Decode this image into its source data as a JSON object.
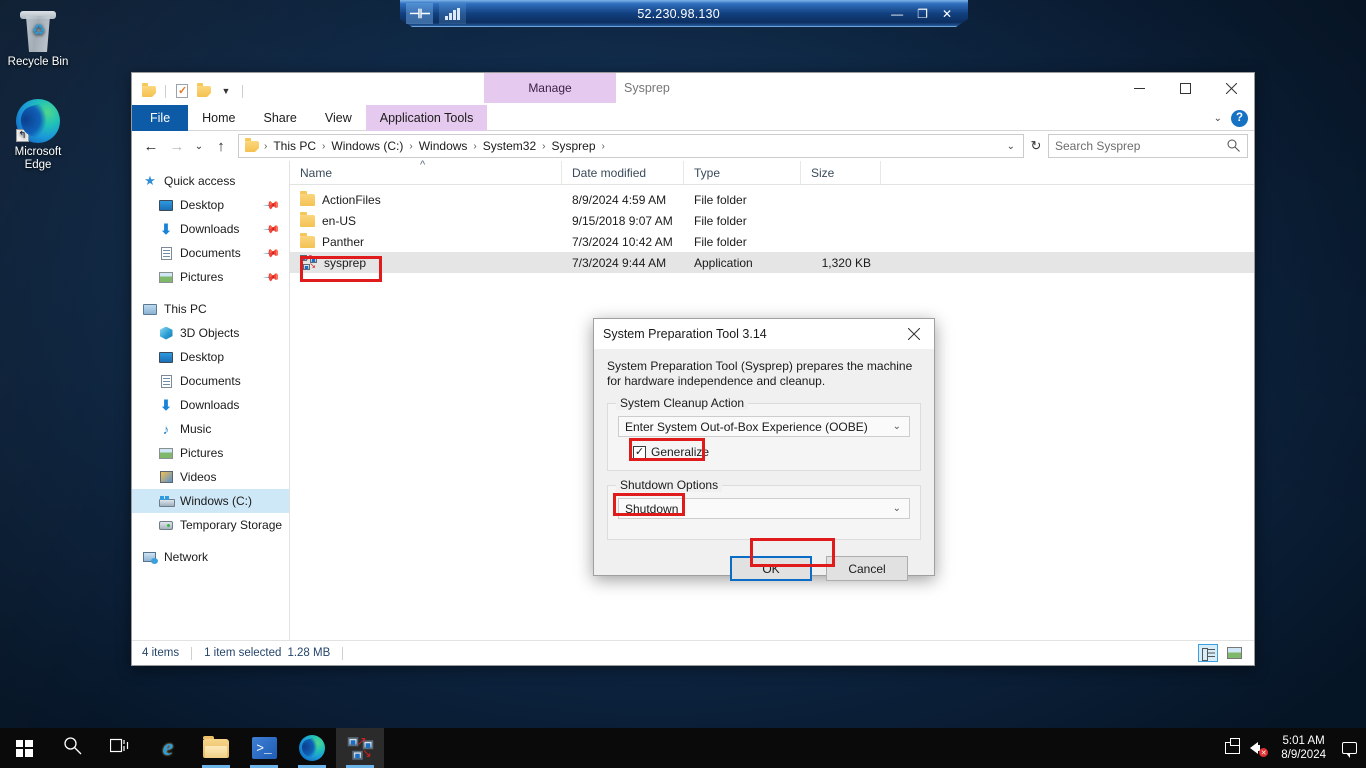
{
  "desktop": {
    "icons": [
      {
        "name": "Recycle Bin",
        "icon": "recycle-bin-icon"
      },
      {
        "name": "Microsoft\nEdge",
        "label_line1": "Microsoft",
        "label_line2": "Edge",
        "icon": "edge-icon"
      }
    ]
  },
  "rdp_bar": {
    "title": "52.230.98.130",
    "pin_icon": "pin-icon",
    "signal_icon": "signal-bars-icon",
    "minimize": "—",
    "restore": "❐",
    "close": "✕"
  },
  "explorer": {
    "window_title": "Sysprep",
    "contextual_tab_header": "Manage",
    "quick_access_toolbar": [
      {
        "name": "folder-icon"
      },
      {
        "name": "properties-icon"
      },
      {
        "name": "new-folder-icon"
      },
      {
        "name": "customize-qat-chevron"
      }
    ],
    "ribbon_tabs": [
      {
        "label": "File",
        "type": "file"
      },
      {
        "label": "Home",
        "type": "normal"
      },
      {
        "label": "Share",
        "type": "normal"
      },
      {
        "label": "View",
        "type": "normal"
      },
      {
        "label": "Application Tools",
        "type": "contextual"
      }
    ],
    "window_controls": {
      "minimize": "minimize",
      "maximize": "maximize",
      "close": "close"
    },
    "ribbon_expand": "⌄",
    "help": "?",
    "address": {
      "back": "←",
      "forward": "→",
      "recent": "⌄",
      "up": "↑",
      "breadcrumbs": [
        "This PC",
        "Windows (C:)",
        "Windows",
        "System32",
        "Sysprep"
      ],
      "separator": "›",
      "dropdown": "⌄",
      "refresh": "↻"
    },
    "search": {
      "placeholder": "Search Sysprep",
      "icon": "search-icon"
    },
    "navigation_pane": [
      {
        "label": "Quick access",
        "icon": "star-icon",
        "level": 0,
        "pinned": false,
        "selected": false
      },
      {
        "label": "Desktop",
        "icon": "monitor-icon",
        "level": 1,
        "pinned": true,
        "selected": false
      },
      {
        "label": "Downloads",
        "icon": "download-icon",
        "level": 1,
        "pinned": true,
        "selected": false
      },
      {
        "label": "Documents",
        "icon": "document-icon",
        "level": 1,
        "pinned": true,
        "selected": false
      },
      {
        "label": "Pictures",
        "icon": "picture-icon",
        "level": 1,
        "pinned": true,
        "selected": false
      },
      {
        "label": "This PC",
        "icon": "pc-icon",
        "level": 0,
        "pinned": false,
        "selected": false
      },
      {
        "label": "3D Objects",
        "icon": "3d-objects-icon",
        "level": 1,
        "pinned": false,
        "selected": false
      },
      {
        "label": "Desktop",
        "icon": "monitor-icon",
        "level": 1,
        "pinned": false,
        "selected": false
      },
      {
        "label": "Documents",
        "icon": "document-icon",
        "level": 1,
        "pinned": false,
        "selected": false
      },
      {
        "label": "Downloads",
        "icon": "download-icon",
        "level": 1,
        "pinned": false,
        "selected": false
      },
      {
        "label": "Music",
        "icon": "music-icon",
        "level": 1,
        "pinned": false,
        "selected": false
      },
      {
        "label": "Pictures",
        "icon": "picture-icon",
        "level": 1,
        "pinned": false,
        "selected": false
      },
      {
        "label": "Videos",
        "icon": "video-icon",
        "level": 1,
        "pinned": false,
        "selected": false
      },
      {
        "label": "Windows (C:)",
        "icon": "drive-icon",
        "level": 1,
        "pinned": false,
        "selected": true
      },
      {
        "label": "Temporary Storage",
        "icon": "temp-drive-icon",
        "level": 1,
        "pinned": false,
        "selected": false
      },
      {
        "label": "Network",
        "icon": "network-icon",
        "level": 0,
        "pinned": false,
        "selected": false
      }
    ],
    "columns": [
      "Name",
      "Date modified",
      "Type",
      "Size"
    ],
    "sort_indicator": "^",
    "files": [
      {
        "name": "ActionFiles",
        "date": "8/9/2024 4:59 AM",
        "type": "File folder",
        "size": "",
        "icon": "folder-icon",
        "selected": false
      },
      {
        "name": "en-US",
        "date": "9/15/2018 9:07 AM",
        "type": "File folder",
        "size": "",
        "icon": "folder-icon",
        "selected": false
      },
      {
        "name": "Panther",
        "date": "7/3/2024 10:42 AM",
        "type": "File folder",
        "size": "",
        "icon": "folder-icon",
        "selected": false
      },
      {
        "name": "sysprep",
        "date": "7/3/2024 9:44 AM",
        "type": "Application",
        "size": "1,320 KB",
        "icon": "sysprep-app-icon",
        "selected": true
      }
    ],
    "status": {
      "item_count": "4 items",
      "selection": "1 item selected",
      "selection_size": "1.28 MB",
      "details_view": "details-view-icon",
      "large_icons_view": "large-icons-view-icon"
    }
  },
  "dialog": {
    "title": "System Preparation Tool 3.14",
    "close": "✕",
    "description": "System Preparation Tool (Sysprep) prepares the machine for hardware independence and cleanup.",
    "cleanup_group": {
      "title": "System Cleanup Action",
      "selected_option": "Enter System Out-of-Box Experience (OOBE)",
      "chevron": "⌄",
      "checkbox_label": "Generalize",
      "checkbox_checked": true,
      "checkbox_mark": "✓"
    },
    "shutdown_group": {
      "title": "Shutdown Options",
      "selected_option": "Shutdown",
      "chevron": "⌄"
    },
    "ok_label": "OK",
    "cancel_label": "Cancel"
  },
  "annotations": {
    "color": "#e01b1b",
    "targets": [
      "sysprep-file-row",
      "generalize-checkbox",
      "shutdown-option",
      "ok-button"
    ]
  },
  "taskbar": {
    "items": [
      {
        "name": "start-button",
        "icon": "windows-logo-icon",
        "running": false,
        "active": false
      },
      {
        "name": "search-button",
        "icon": "search-icon",
        "running": false,
        "active": false
      },
      {
        "name": "task-view-button",
        "icon": "task-view-icon",
        "running": false,
        "active": false
      },
      {
        "name": "internet-explorer-button",
        "icon": "internet-explorer-icon",
        "running": false,
        "active": false
      },
      {
        "name": "file-explorer-button",
        "icon": "file-explorer-icon",
        "running": true,
        "active": false
      },
      {
        "name": "powershell-button",
        "icon": "powershell-icon",
        "running": true,
        "active": false
      },
      {
        "name": "edge-button",
        "icon": "edge-icon",
        "running": true,
        "active": false
      },
      {
        "name": "sysprep-button",
        "icon": "sysprep-app-icon",
        "running": true,
        "active": true
      }
    ],
    "tray": {
      "network_icon": "remote-monitor-icon",
      "volume_icon": "speaker-muted-icon",
      "time": "5:01 AM",
      "date": "8/9/2024",
      "action_center_icon": "notification-bubble-icon"
    }
  }
}
